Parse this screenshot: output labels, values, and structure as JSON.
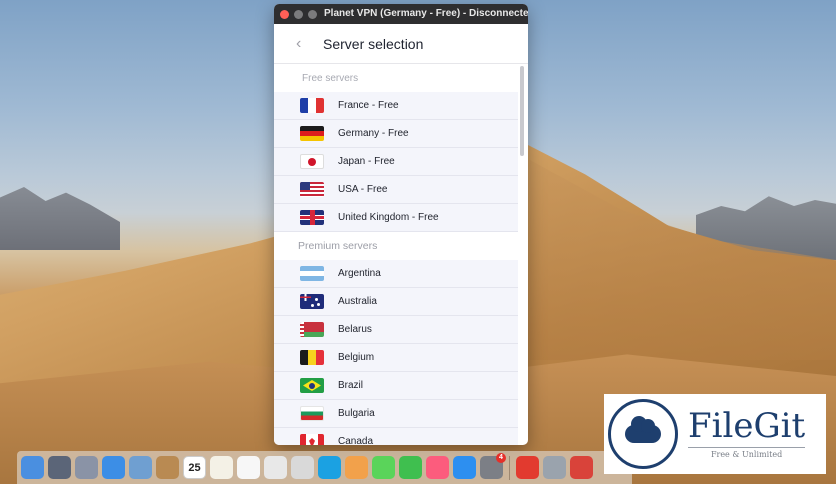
{
  "window": {
    "title": "Planet VPN (Germany - Free) - Disconnected",
    "header_title": "Server selection"
  },
  "free_section": {
    "label": "Free servers",
    "servers": [
      {
        "name": "France - Free",
        "flag": "fr"
      },
      {
        "name": "Germany - Free",
        "flag": "de"
      },
      {
        "name": "Japan - Free",
        "flag": "jp"
      },
      {
        "name": "USA - Free",
        "flag": "us"
      },
      {
        "name": "United Kingdom - Free",
        "flag": "gb"
      }
    ]
  },
  "premium_section": {
    "label": "Premium servers",
    "servers": [
      {
        "name": "Argentina",
        "flag": "ar"
      },
      {
        "name": "Australia",
        "flag": "au"
      },
      {
        "name": "Belarus",
        "flag": "by"
      },
      {
        "name": "Belgium",
        "flag": "be"
      },
      {
        "name": "Brazil",
        "flag": "br"
      },
      {
        "name": "Bulgaria",
        "flag": "bg"
      },
      {
        "name": "Canada",
        "flag": "ca"
      }
    ]
  },
  "dock": {
    "calendar_day": "25",
    "badge_count": "4",
    "icons": [
      "finder-icon",
      "launchpad-icon",
      "rocket-icon",
      "safari-icon",
      "preview-icon",
      "notes-icon",
      "calendar-icon",
      "notes-paper-icon",
      "reminders-icon",
      "chrome-icon",
      "tools-icon",
      "skype-icon",
      "photos-icon",
      "messages-icon",
      "facetime-icon",
      "music-icon",
      "app-store-icon",
      "system-preferences-icon",
      "planet-vpn-icon",
      "image-capture-icon",
      "red-app-icon"
    ]
  },
  "watermark": {
    "brand": "FileGit",
    "tagline": "Free & Unlimited"
  },
  "colors": {
    "titlebar": "#2e2e30",
    "row_bg": "#f4f5fb",
    "brand_blue": "#1e3f6e"
  }
}
